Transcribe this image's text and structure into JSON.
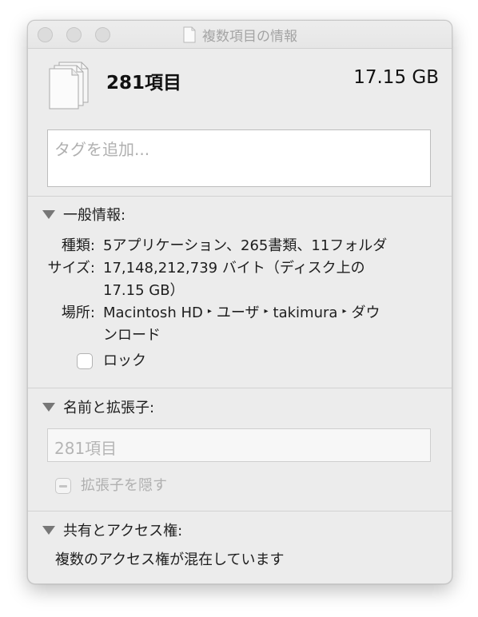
{
  "window": {
    "title": "複数項目の情報"
  },
  "header": {
    "item_count": "281項目",
    "total_size": "17.15 GB"
  },
  "tags": {
    "placeholder": "タグを追加..."
  },
  "general": {
    "heading": "一般情報:",
    "kind_label": "種類:",
    "kind_value": "5アプリケーション、265書類、11フォルダ",
    "size_label": "サイズ:",
    "size_value_line1": "17,148,212,739 バイト（ディスク上の",
    "size_value_line2": "17.15 GB）",
    "location_label": "場所:",
    "location_path": [
      "Macintosh HD",
      "ユーザ",
      "takimura",
      "ダウ"
    ],
    "location_path_cont": "ンロード",
    "location_separator": "▸",
    "lock_label": "ロック",
    "lock_checked": false
  },
  "name_ext": {
    "heading": "名前と拡張子:",
    "name_value": "281項目",
    "hide_ext_label": "拡張子を隠す",
    "hide_ext_state": "mixed"
  },
  "sharing": {
    "heading": "共有とアクセス権:",
    "status": "複数のアクセス権が混在しています"
  }
}
